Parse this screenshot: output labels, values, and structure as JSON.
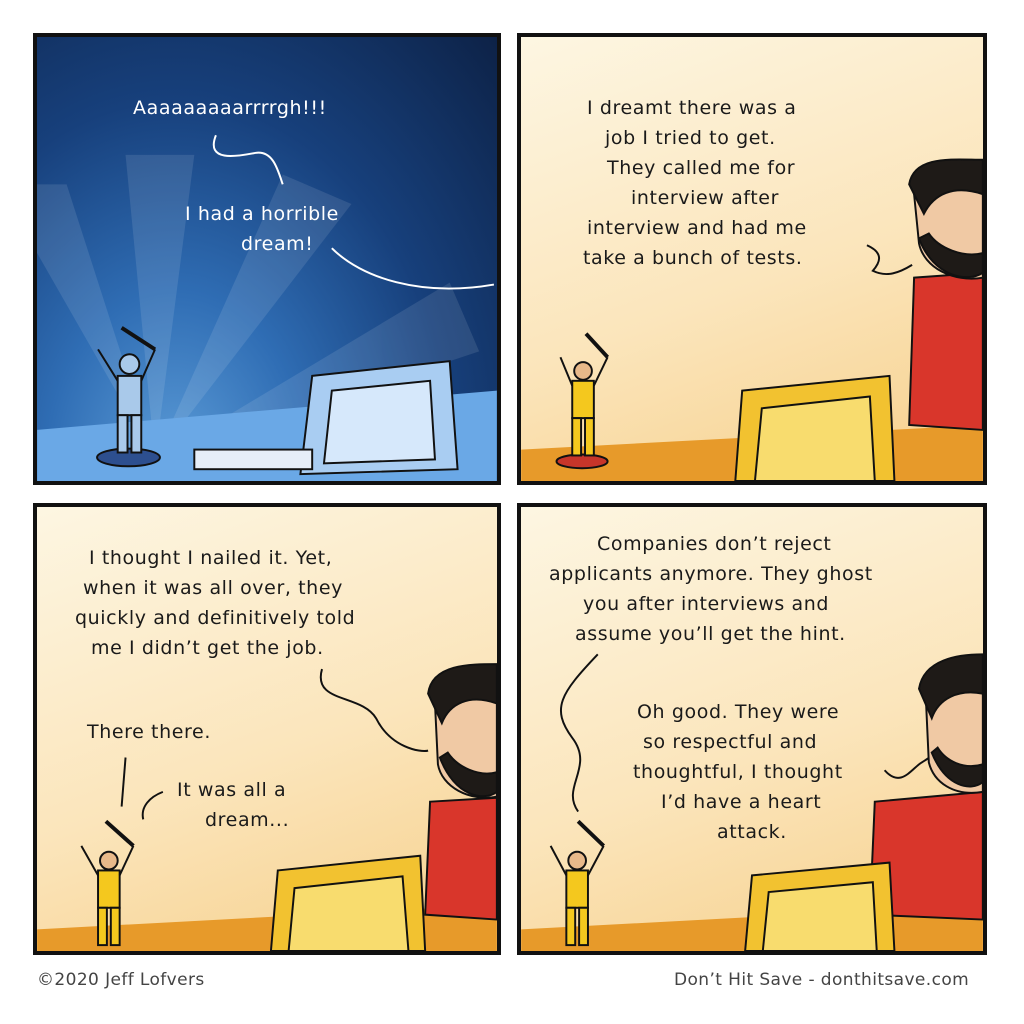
{
  "panels": [
    {
      "texts": [
        "Aaaaaaaaarrrrgh!!!",
        "I had a horrible",
        "dream!"
      ]
    },
    {
      "texts": [
        "I dreamt there was a",
        "job I tried to get.",
        "They called me for",
        "interview after",
        "interview and had me",
        "take a bunch of tests."
      ]
    },
    {
      "texts": [
        "I thought I nailed it. Yet,",
        "when it was all over, they",
        "quickly and definitively told",
        "me I didn’t get the job.",
        "There there.",
        "It was all a",
        "dream..."
      ]
    },
    {
      "texts": [
        "Companies don’t reject",
        "applicants anymore. They ghost",
        "you after interviews and",
        "assume you’ll get the hint.",
        "Oh good. They were",
        "so respectful and",
        "thoughtful, I thought",
        "I’d have a heart",
        "attack."
      ]
    }
  ],
  "footer": {
    "copyright": "©2020 Jeff Lofvers",
    "site": "Don’t Hit Save - donthitsave.com"
  },
  "colors": {
    "night_sky": "#17407c",
    "warm_background": "#fbe5bb",
    "shirt_red": "#d9362b",
    "monitor_yellow": "#f2c230",
    "figure_yellow": "#f4c81e",
    "figure_blue_night": "#a9c9ea"
  }
}
